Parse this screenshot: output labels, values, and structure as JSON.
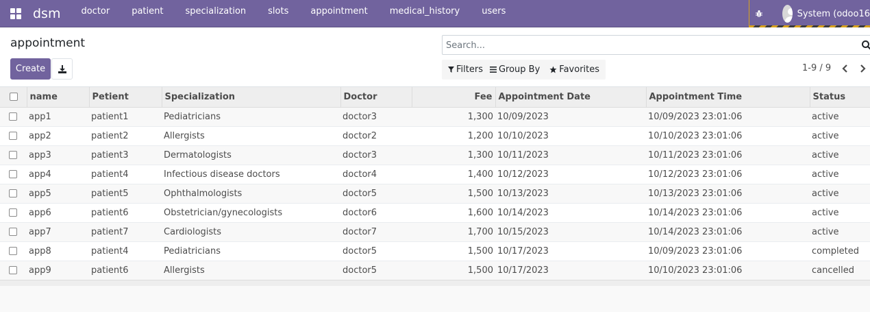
{
  "navbar": {
    "brand": "dsm",
    "menu": [
      "doctor",
      "patient",
      "specialization",
      "slots",
      "appointment",
      "medical_history",
      "users"
    ],
    "user_name": "System (odoo16",
    "colors": {
      "navbar_bg": "#71639e",
      "debug_accent": "#d9a21b"
    }
  },
  "control_panel": {
    "breadcrumb": "appointment",
    "create_label": "Create",
    "search_placeholder": "Search...",
    "filters_label": "Filters",
    "group_by_label": "Group By",
    "favorites_label": "Favorites",
    "pager_value": "1-9 / 9"
  },
  "table": {
    "columns": [
      "name",
      "Petient",
      "Specialization",
      "Doctor",
      "Fee",
      "Appointment Date",
      "Appointment Time",
      "Status"
    ],
    "rows": [
      [
        "app1",
        "patient1",
        "Pediatricians",
        "doctor3",
        "1,300",
        "10/09/2023",
        "10/09/2023 23:01:06",
        "active"
      ],
      [
        "app2",
        "patient2",
        "Allergists",
        "doctor2",
        "1,200",
        "10/10/2023",
        "10/10/2023 23:01:06",
        "active"
      ],
      [
        "app3",
        "patient3",
        "Dermatologists",
        "doctor3",
        "1,300",
        "10/11/2023",
        "10/11/2023 23:01:06",
        "active"
      ],
      [
        "app4",
        "patient4",
        "Infectious disease doctors",
        "doctor4",
        "1,400",
        "10/12/2023",
        "10/12/2023 23:01:06",
        "active"
      ],
      [
        "app5",
        "patient5",
        "Ophthalmologists",
        "doctor5",
        "1,500",
        "10/13/2023",
        "10/13/2023 23:01:06",
        "active"
      ],
      [
        "app6",
        "patient6",
        "Obstetrician/gynecologists",
        "doctor6",
        "1,600",
        "10/14/2023",
        "10/14/2023 23:01:06",
        "active"
      ],
      [
        "app7",
        "patient7",
        "Cardiologists",
        "doctor7",
        "1,700",
        "10/15/2023",
        "10/14/2023 23:01:06",
        "active"
      ],
      [
        "app8",
        "patient4",
        "Pediatricians",
        "doctor5",
        "1,500",
        "10/17/2023",
        "10/09/2023 23:01:06",
        "completed"
      ],
      [
        "app9",
        "patient6",
        "Allergists",
        "doctor5",
        "1,500",
        "10/17/2023",
        "10/10/2023 23:01:06",
        "cancelled"
      ]
    ]
  },
  "icons": {
    "apps": "apps-grid-icon",
    "debug": "bug-icon",
    "download": "download-icon",
    "search": "search-icon",
    "filter": "filter-icon",
    "group_by": "bars-icon",
    "favorites": "star-icon"
  }
}
